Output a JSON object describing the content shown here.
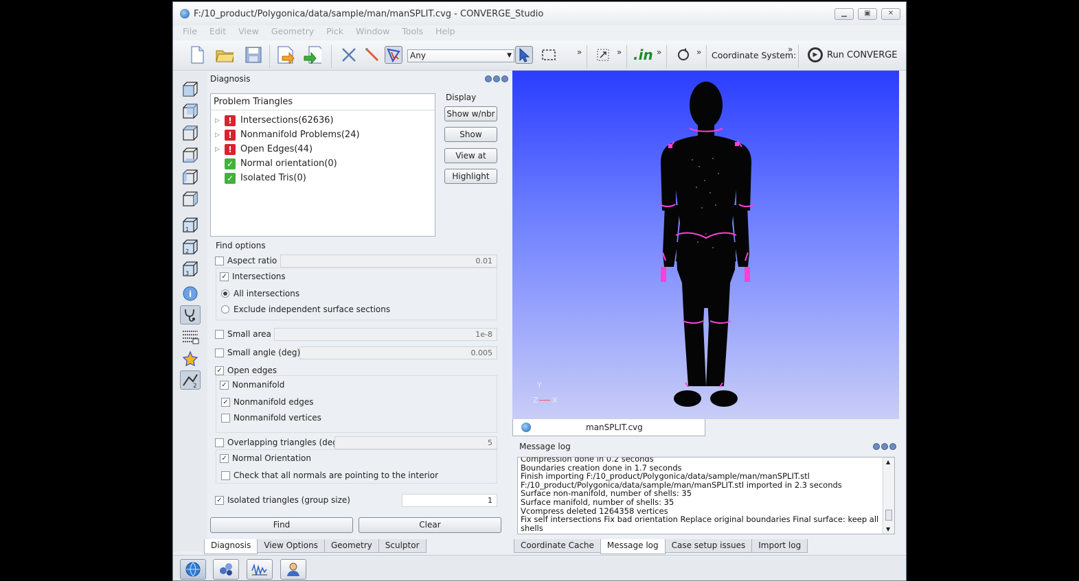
{
  "window": {
    "title": "F:/10_product/Polygonica/data/sample/man/manSPLIT.cvg - CONVERGE_Studio"
  },
  "menu": [
    "File",
    "Edit",
    "View",
    "Geometry",
    "Pick",
    "Window",
    "Tools",
    "Help"
  ],
  "toolbar": {
    "pick_filter": "Any",
    "chevron": "»",
    "in_label": ".in",
    "coordinate_system": "Coordinate System:",
    "run_converge": "Run CONVERGE"
  },
  "diagnosis": {
    "title": "Diagnosis",
    "problem_header": "Problem Triangles",
    "problems": [
      {
        "label": "Intersections(62636)",
        "status": "bad"
      },
      {
        "label": "Nonmanifold Problems(24)",
        "status": "bad"
      },
      {
        "label": "Open Edges(44)",
        "status": "bad"
      },
      {
        "label": "Normal orientation(0)",
        "status": "good"
      },
      {
        "label": "Isolated Tris(0)",
        "status": "good"
      }
    ],
    "display_label": "Display",
    "display_buttons": [
      "Show w/nbr",
      "Show",
      "View at",
      "Highlight"
    ],
    "find_options_label": "Find options",
    "aspect_ratio": {
      "label": "Aspect ratio",
      "value": "0.01"
    },
    "intersections": {
      "label": "Intersections"
    },
    "all_intersections": "All intersections",
    "exclude_independent": "Exclude independent surface sections",
    "small_area": {
      "label": "Small area",
      "value": "1e-8"
    },
    "small_angle": {
      "label": "Small angle (deg)",
      "value": "0.005"
    },
    "open_edges": "Open edges",
    "nonmanifold": "Nonmanifold",
    "nonmanifold_edges": "Nonmanifold edges",
    "nonmanifold_vertices": "Nonmanifold vertices",
    "overlapping": {
      "label": "Overlapping triangles (deg)",
      "value": "5"
    },
    "normal_orientation": "Normal Orientation",
    "check_normals": "Check that all normals are pointing to the interior",
    "isolated": {
      "label": "Isolated triangles (group size)",
      "value": "1"
    },
    "find_button": "Find",
    "clear_button": "Clear",
    "tabs": [
      "Diagnosis",
      "View Options",
      "Geometry",
      "Sculptor"
    ]
  },
  "viewport": {
    "axis_y": "Y",
    "axis_z": "Z",
    "axis_x": "X",
    "tab_label": "manSPLIT.cvg"
  },
  "message_log": {
    "title": "Message log",
    "lines": [
      "Compression done in 0.2 seconds",
      "Boundaries creation done in 1.7 seconds",
      "Finish importing F:/10_product/Polygonica/data/sample/man/manSPLIT.stl",
      "F:/10_product/Polygonica/data/sample/man/manSPLIT.stl imported in 2.3 seconds",
      "Surface non-manifold, number of shells: 35",
      "Surface manifold, number of shells: 35",
      "Vcompress deleted 1264358 vertices",
      "Fix self intersections Fix bad orientation Replace original boundaries  Final surface: keep all shells"
    ],
    "tabs": [
      "Coordinate Cache",
      "Message log",
      "Case setup issues",
      "Import log"
    ]
  },
  "colors": {
    "accent": "#2a3dff",
    "problem_red": "#d7242f",
    "ok_green": "#42b23b",
    "highlight_magenta": "#ff3fd8"
  }
}
